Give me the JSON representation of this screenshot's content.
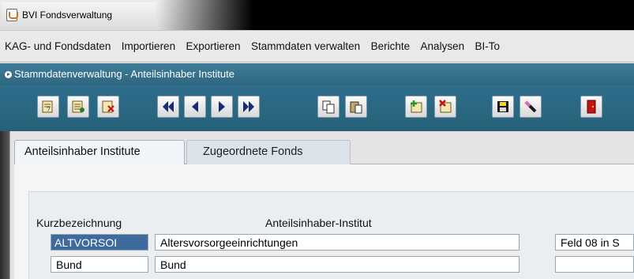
{
  "window": {
    "title": "BVI Fondsverwaltung",
    "icon": "java-cup-icon"
  },
  "menubar": {
    "items": [
      {
        "label": "KAG- und Fondsdaten"
      },
      {
        "label": "Importieren"
      },
      {
        "label": "Exportieren"
      },
      {
        "label": "Stammdaten verwalten"
      },
      {
        "label": "Berichte"
      },
      {
        "label": "Analysen"
      },
      {
        "label": "BI-To"
      }
    ]
  },
  "form": {
    "title": "Stammdatenverwaltung  -  Anteilsinhaber Institute"
  },
  "toolbar": {
    "buttons": [
      {
        "icon": "query-icon"
      },
      {
        "icon": "execute-query-icon"
      },
      {
        "icon": "cancel-query-icon"
      },
      {
        "icon": "first-record-icon"
      },
      {
        "icon": "previous-record-icon"
      },
      {
        "icon": "next-record-icon"
      },
      {
        "icon": "last-record-icon"
      },
      {
        "icon": "copy-icon"
      },
      {
        "icon": "paste-icon"
      },
      {
        "icon": "insert-record-icon"
      },
      {
        "icon": "delete-record-icon"
      },
      {
        "icon": "save-icon"
      },
      {
        "icon": "edit-icon"
      },
      {
        "icon": "exit-icon"
      }
    ]
  },
  "tabs": [
    {
      "label": "Anteilsinhaber Institute",
      "active": true
    },
    {
      "label": "Zugeordnete Fonds",
      "active": false
    }
  ],
  "grid": {
    "headers": {
      "kurz": "Kurzbezeichnung",
      "institut": "Anteilsinhaber-Institut"
    },
    "rows": [
      {
        "kurz": "ALTVORSOI",
        "institut": "Altersvorsorgeeinrichtungen",
        "extra": "Feld 08 in S"
      },
      {
        "kurz": "Bund",
        "institut": "Bund",
        "extra": ""
      }
    ]
  },
  "colors": {
    "form_header": "#2e6680",
    "toolbar": "#276178",
    "selection": "#3e6a9e"
  }
}
